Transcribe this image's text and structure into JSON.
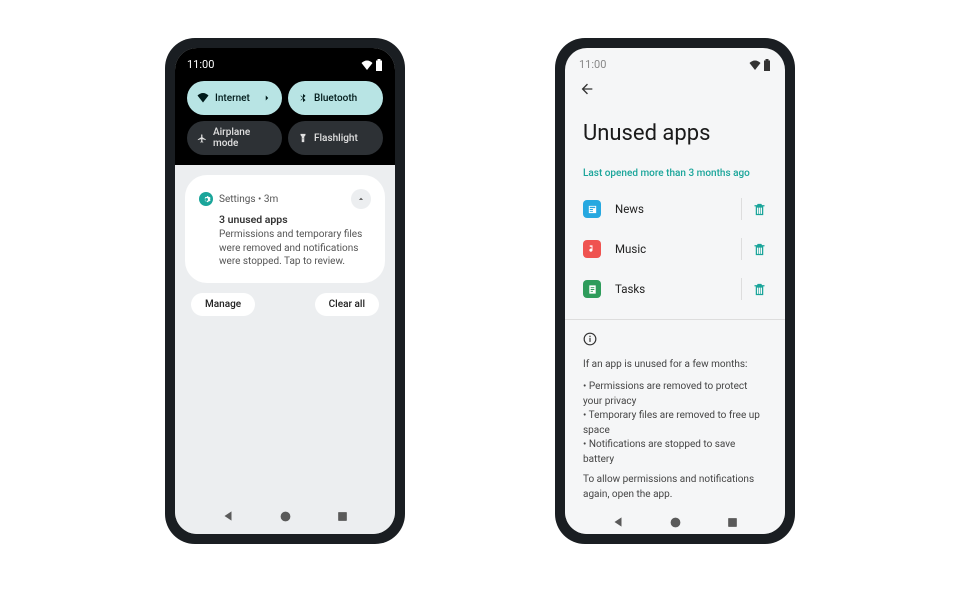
{
  "status": {
    "time": "11:00"
  },
  "quicksettings": {
    "internet": "Internet",
    "bluetooth": "Bluetooth",
    "airplane": "Airplane mode",
    "flashlight": "Flashlight"
  },
  "notification": {
    "source": "Settings • 3m",
    "title": "3 unused apps",
    "body": "Permissions and temporary files were removed and notifications were stopped. Tap to review.",
    "manage": "Manage",
    "clear": "Clear all"
  },
  "unused_page": {
    "title": "Unused apps",
    "section_label": "Last opened more than 3 months ago",
    "apps": {
      "news": "News",
      "music": "Music",
      "tasks": "Tasks"
    },
    "info_heading": "If an app is unused for a few months:",
    "bullet1": "Permissions are removed to protect your privacy",
    "bullet2": "Temporary files are removed to free up space",
    "bullet3": "Notifications are stopped to save battery",
    "info_footer": "To allow permissions and notifications again, open the app."
  }
}
